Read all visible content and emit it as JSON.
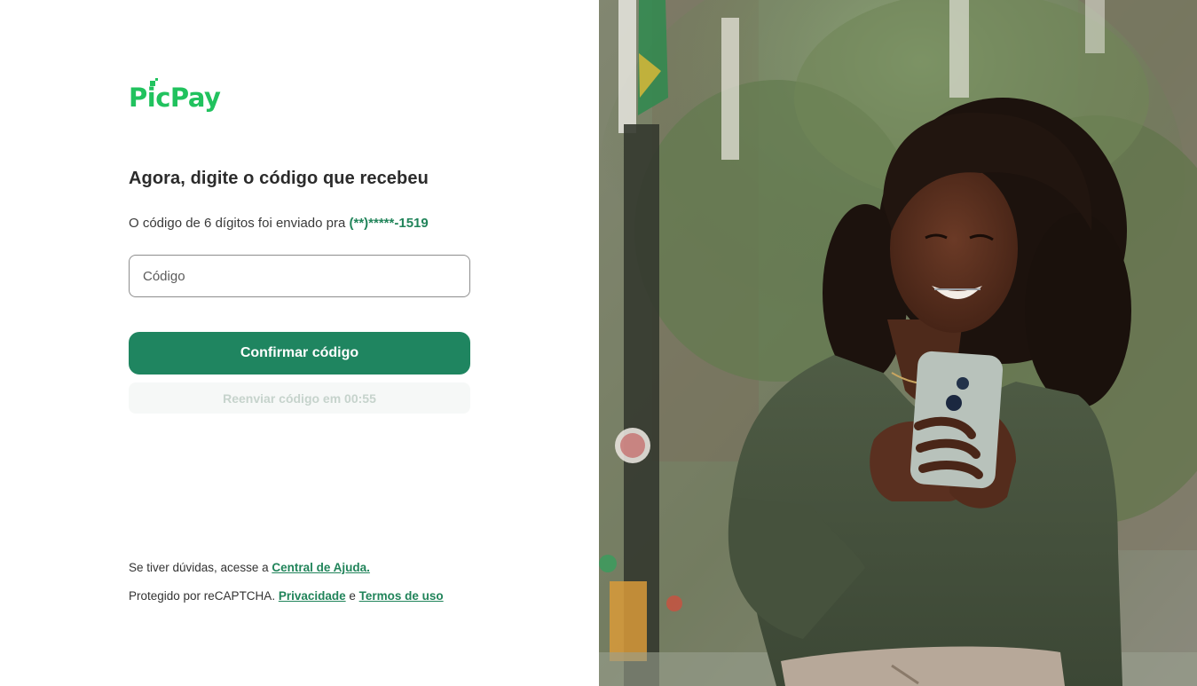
{
  "brand": {
    "logo_text": "PicPay",
    "colors": {
      "primary": "#1f8560",
      "logo_green": "#21c25e",
      "link": "#21845a",
      "resend_disabled_text": "#c6d3cc"
    }
  },
  "main": {
    "title": "Agora, digite o código que recebeu",
    "subtitle_prefix": "O código de 6 dígitos foi enviado pra ",
    "masked_phone": "(**)*****-1519",
    "code_input": {
      "placeholder": "Código",
      "value": ""
    },
    "confirm_button_label": "Confirmar código",
    "resend_button_label": "Reenviar código em 00:55",
    "resend_countdown": "00:55"
  },
  "footer": {
    "help_prefix": "Se tiver dúvidas, acesse a ",
    "help_link": "Central de Ajuda.",
    "recaptcha_prefix": "Protegido por reCAPTCHA. ",
    "privacy_link": "Privacidade",
    "conjunction": " e ",
    "terms_link": "Termos de uso"
  },
  "hero_image": {
    "subject": "smiling woman with curly hair holding a smartphone in a city street"
  }
}
